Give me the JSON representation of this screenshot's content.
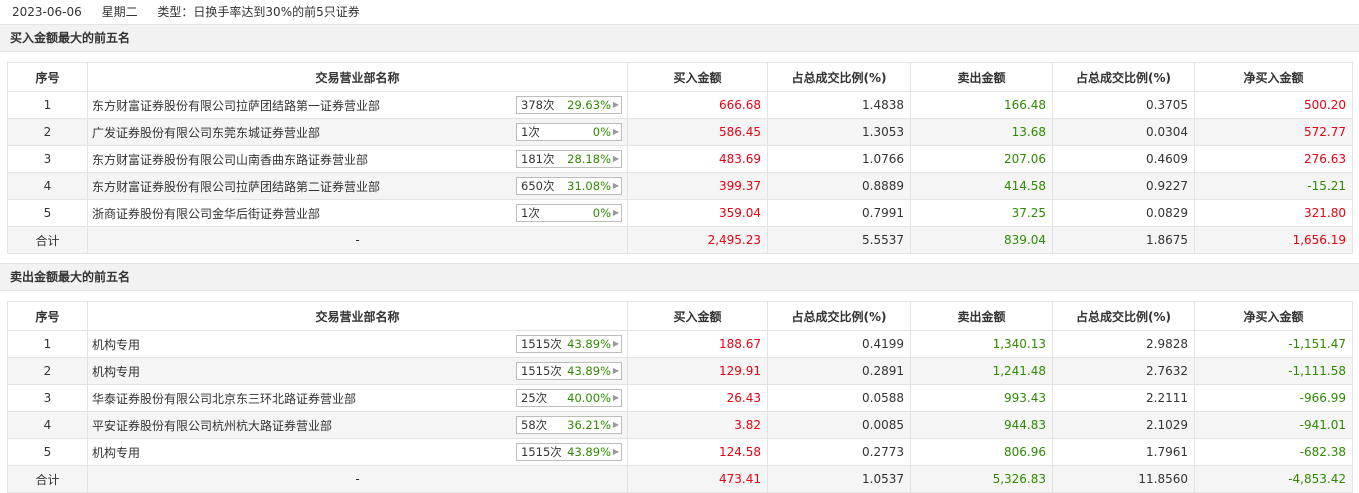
{
  "header": {
    "date": "2023-06-06",
    "weekday": "星期二",
    "type_text": "类型：日换手率达到30%的前5只证券"
  },
  "columns": [
    "序号",
    "交易营业部名称",
    "买入金额",
    "占总成交比例(%)",
    "卖出金额",
    "占总成交比例(%)",
    "净买入金额"
  ],
  "buy_section": {
    "title": "买入金额最大的前五名",
    "rows": [
      {
        "no": "1",
        "name": "东方财富证券股份有限公司拉萨团结路第一证券营业部",
        "count": "378次",
        "pct": "29.63%",
        "buy": "666.68",
        "buy_ratio": "1.4838",
        "sell": "166.48",
        "sell_ratio": "0.3705",
        "net": "500.20"
      },
      {
        "no": "2",
        "name": "广发证券股份有限公司东莞东城证券营业部",
        "count": "1次",
        "pct": "0%",
        "buy": "586.45",
        "buy_ratio": "1.3053",
        "sell": "13.68",
        "sell_ratio": "0.0304",
        "net": "572.77"
      },
      {
        "no": "3",
        "name": "东方财富证券股份有限公司山南香曲东路证券营业部",
        "count": "181次",
        "pct": "28.18%",
        "buy": "483.69",
        "buy_ratio": "1.0766",
        "sell": "207.06",
        "sell_ratio": "0.4609",
        "net": "276.63"
      },
      {
        "no": "4",
        "name": "东方财富证券股份有限公司拉萨团结路第二证券营业部",
        "count": "650次",
        "pct": "31.08%",
        "buy": "399.37",
        "buy_ratio": "0.8889",
        "sell": "414.58",
        "sell_ratio": "0.9227",
        "net": "-15.21"
      },
      {
        "no": "5",
        "name": "浙商证券股份有限公司金华后街证券营业部",
        "count": "1次",
        "pct": "0%",
        "buy": "359.04",
        "buy_ratio": "0.7991",
        "sell": "37.25",
        "sell_ratio": "0.0829",
        "net": "321.80"
      }
    ],
    "total": {
      "label": "合计",
      "name": "-",
      "buy": "2,495.23",
      "buy_ratio": "5.5537",
      "sell": "839.04",
      "sell_ratio": "1.8675",
      "net": "1,656.19"
    }
  },
  "sell_section": {
    "title": "卖出金额最大的前五名",
    "rows": [
      {
        "no": "1",
        "name": "机构专用",
        "count": "1515次",
        "pct": "43.89%",
        "buy": "188.67",
        "buy_ratio": "0.4199",
        "sell": "1,340.13",
        "sell_ratio": "2.9828",
        "net": "-1,151.47"
      },
      {
        "no": "2",
        "name": "机构专用",
        "count": "1515次",
        "pct": "43.89%",
        "buy": "129.91",
        "buy_ratio": "0.2891",
        "sell": "1,241.48",
        "sell_ratio": "2.7632",
        "net": "-1,111.58"
      },
      {
        "no": "3",
        "name": "华泰证券股份有限公司北京东三环北路证券营业部",
        "count": "25次",
        "pct": "40.00%",
        "buy": "26.43",
        "buy_ratio": "0.0588",
        "sell": "993.43",
        "sell_ratio": "2.2111",
        "net": "-966.99"
      },
      {
        "no": "4",
        "name": "平安证券股份有限公司杭州杭大路证券营业部",
        "count": "58次",
        "pct": "36.21%",
        "buy": "3.82",
        "buy_ratio": "0.0085",
        "sell": "944.83",
        "sell_ratio": "2.1029",
        "net": "-941.01"
      },
      {
        "no": "5",
        "name": "机构专用",
        "count": "1515次",
        "pct": "43.89%",
        "buy": "124.58",
        "buy_ratio": "0.2773",
        "sell": "806.96",
        "sell_ratio": "1.7961",
        "net": "-682.38"
      }
    ],
    "total": {
      "label": "合计",
      "name": "-",
      "buy": "473.41",
      "buy_ratio": "1.0537",
      "sell": "5,326.83",
      "sell_ratio": "11.8560",
      "net": "-4,853.42"
    }
  },
  "colors": {
    "buy": "#e60012",
    "sell": "#2e8b00",
    "section_bg": "#f2f2f2",
    "row_alt_bg": "#f5f5f5"
  },
  "icons": {
    "badge_arrow": "caret-right-icon"
  }
}
